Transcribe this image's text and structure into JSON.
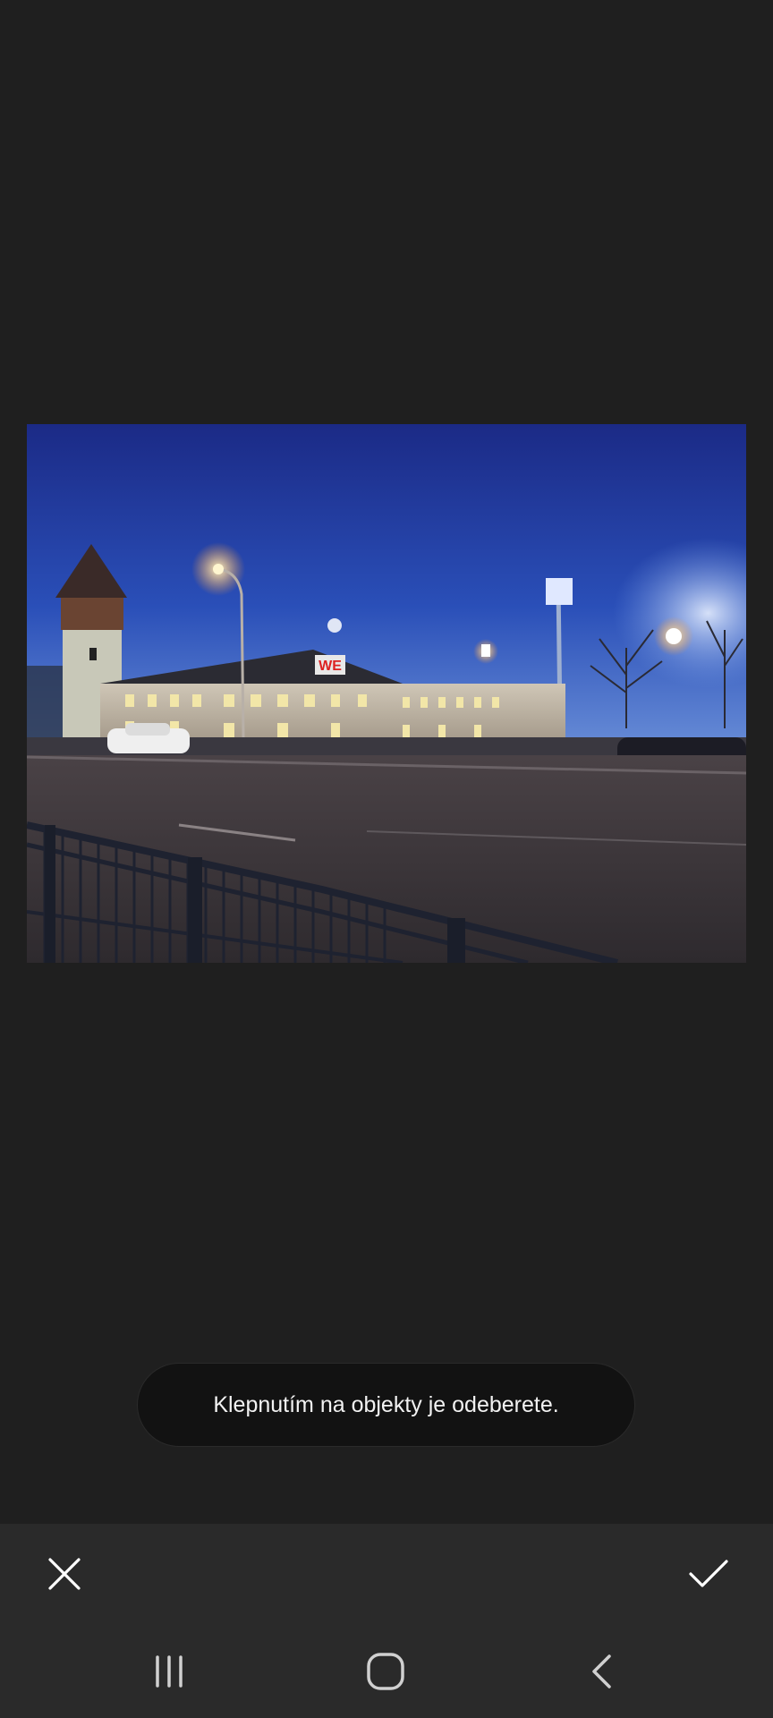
{
  "editor": {
    "hint_text": "Klepnutím na objekty je odeberete.",
    "cancel_icon": "close-icon",
    "confirm_icon": "check-icon"
  },
  "photo": {
    "subject": "Street at dusk with illuminated building, tower and stadium floodlights",
    "sign_text": "WE"
  },
  "navigation": {
    "recents_icon": "recent-apps-icon",
    "home_icon": "home-icon",
    "back_icon": "back-icon"
  },
  "colors": {
    "background": "#1f1f1f",
    "toolbar": "#2a2a2a",
    "toast_bg": "#121212",
    "icon": "#ffffff",
    "nav_icon": "#d0d0d0"
  }
}
